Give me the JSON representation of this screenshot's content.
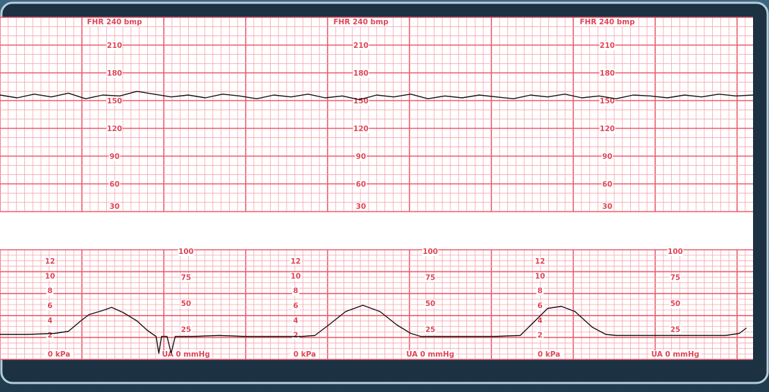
{
  "chart_data": [
    {
      "type": "line",
      "panel": "fetal-heart-rate",
      "scale_label": "FHR  240  bmp",
      "ylim": [
        30,
        240
      ],
      "tick_labels": [
        "210",
        "180",
        "150",
        "120",
        "90",
        "60",
        "30"
      ],
      "grid": true,
      "series": [
        {
          "x": [
            0,
            25,
            50,
            75,
            100,
            125,
            150,
            175,
            200,
            225,
            250,
            275,
            300,
            325,
            350,
            375,
            400,
            425,
            450,
            475,
            500,
            525,
            550,
            575,
            600,
            625,
            650,
            675,
            700,
            725,
            750,
            775,
            800,
            825,
            850,
            875,
            900,
            925,
            950,
            975,
            1000,
            1025,
            1050,
            1075,
            1100
          ],
          "values": [
            156,
            153,
            157,
            154,
            158,
            152,
            156,
            155,
            160,
            157,
            154,
            156,
            153,
            157,
            155,
            152,
            156,
            154,
            157,
            153,
            155,
            151,
            156,
            154,
            157,
            152,
            155,
            153,
            156,
            154,
            152,
            156,
            154,
            157,
            153,
            155,
            152,
            156,
            155,
            153,
            156,
            154,
            157,
            155,
            156
          ]
        }
      ]
    },
    {
      "type": "line",
      "panel": "uterine-activity",
      "scale_labels": [
        "0  kPa",
        "UA  0  mmHg"
      ],
      "kpa_tick_labels": [
        "12",
        "10",
        "8",
        "6",
        "4",
        "2"
      ],
      "mmhg_tick_labels": [
        "100",
        "75",
        "50",
        "25"
      ],
      "ylim_mmhg": [
        0,
        100
      ],
      "grid": true,
      "series": [
        {
          "x": [
            0,
            40,
            80,
            100,
            118,
            130,
            150,
            163,
            180,
            200,
            215,
            228,
            232,
            236,
            244,
            250,
            256,
            280,
            320,
            360,
            400,
            440,
            460,
            480,
            505,
            530,
            555,
            580,
            600,
            615,
            640,
            680,
            720,
            760,
            780,
            800,
            820,
            840,
            865,
            885,
            900,
            940,
            1000,
            1060,
            1080,
            1090
          ],
          "values": [
            20,
            20,
            21,
            23,
            33,
            39,
            43,
            46,
            41,
            33,
            24,
            18,
            2,
            18,
            18,
            2,
            18,
            18,
            19,
            18,
            18,
            18,
            19,
            29,
            42,
            48,
            42,
            29,
            21,
            18,
            18,
            18,
            18,
            19,
            32,
            45,
            47,
            42,
            27,
            20,
            19,
            19,
            19,
            19,
            21,
            26
          ]
        }
      ]
    }
  ]
}
